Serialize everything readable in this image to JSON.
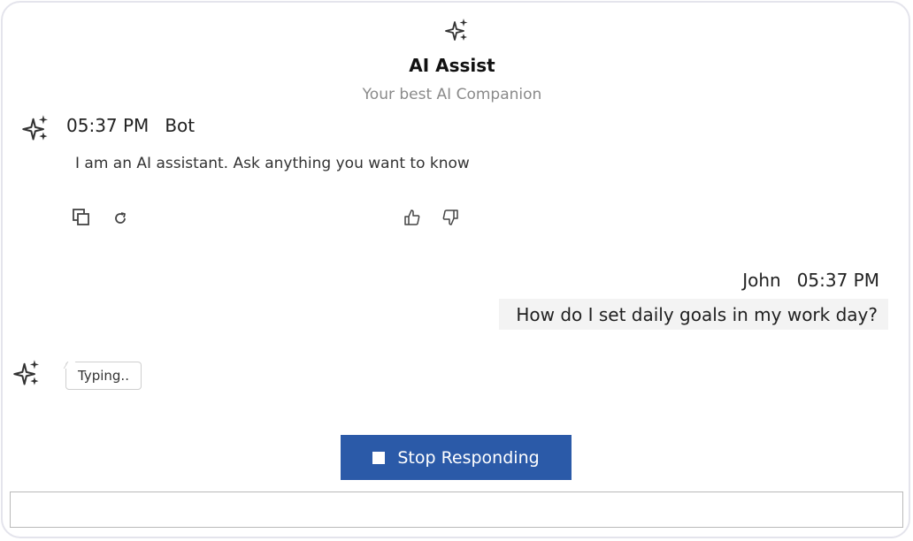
{
  "header": {
    "icon": "sparkle-icon",
    "title": "AI Assist",
    "subtitle": "Your best AI Companion"
  },
  "messages": [
    {
      "role": "bot",
      "time": "05:37 PM",
      "author": "Bot",
      "text": "I am an AI assistant. Ask anything you want to know",
      "toolbar": [
        "copy-icon",
        "regenerate-icon",
        "thumbs-up-icon",
        "thumbs-down-icon"
      ]
    },
    {
      "role": "user",
      "author": "John",
      "time": "05:37 PM",
      "text": "How do I set daily goals in my work day?"
    }
  ],
  "typing": {
    "text": "Typing.."
  },
  "stop_button": {
    "label": "Stop Responding",
    "color": "#2b5aa8"
  },
  "input": {
    "value": "",
    "placeholder": ""
  }
}
